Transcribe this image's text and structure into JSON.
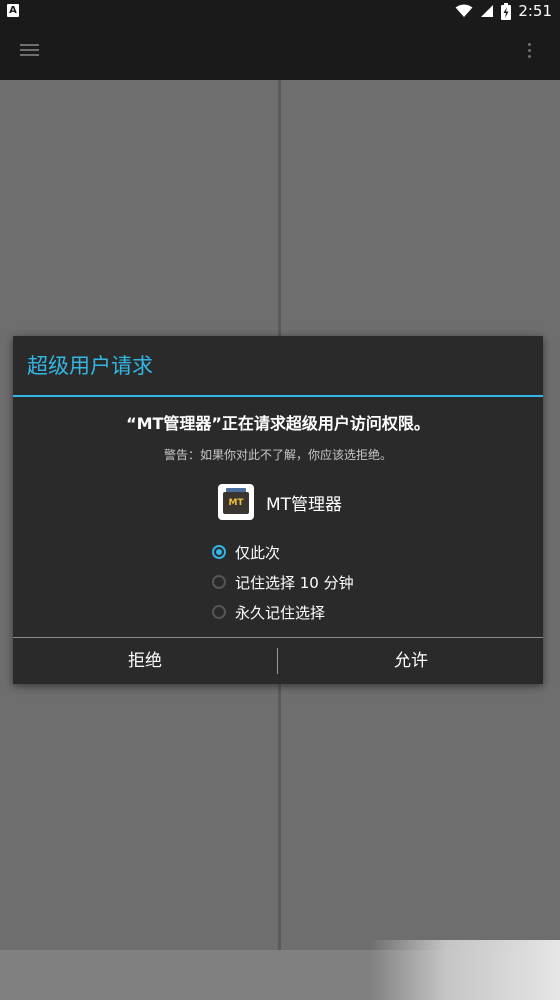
{
  "status_bar": {
    "notification_icon": "A",
    "time": "2:51",
    "icons": [
      "wifi-icon",
      "cellular-signal-icon",
      "battery-charging-icon"
    ]
  },
  "toolbar": {
    "menu_icon": "hamburger-menu-icon",
    "overflow_icon": "more-vertical-icon"
  },
  "dialog": {
    "title": "超级用户请求",
    "message": "“MT管理器”正在请求超级用户访问权限。",
    "warning": "警告：如果你对此不了解，你应该选拒绝。",
    "app_name": "MT管理器",
    "app_icon_text": "MT",
    "options": [
      {
        "label": "仅此次",
        "checked": true
      },
      {
        "label": "记住选择 10 分钟",
        "checked": false
      },
      {
        "label": "永久记住选择",
        "checked": false
      }
    ],
    "deny_label": "拒绝",
    "allow_label": "允许"
  },
  "colors": {
    "accent": "#33b5e5",
    "dialog_background": "#2a2a2a",
    "bar_background": "#1a1a1a"
  }
}
